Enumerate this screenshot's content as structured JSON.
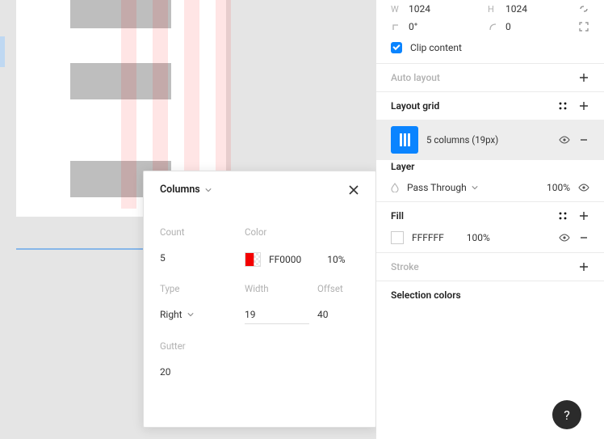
{
  "popup": {
    "title": "Columns",
    "count_label": "Count",
    "count_value": "5",
    "color_label": "Color",
    "color_hex": "FF0000",
    "color_opacity": "10%",
    "type_label": "Type",
    "type_value": "Right",
    "width_label": "Width",
    "width_value": "19",
    "offset_label": "Offset",
    "offset_value": "40",
    "gutter_label": "Gutter",
    "gutter_value": "20"
  },
  "panel": {
    "dim": {
      "w_label": "W",
      "w_value": "1024",
      "h_label": "H",
      "h_value": "1024",
      "r_label_icon": "rotation",
      "r_value": "0°",
      "c_label_icon": "corner",
      "c_value": "0"
    },
    "clip_label": "Clip content",
    "auto_layout": "Auto layout",
    "layout_grid": {
      "title": "Layout grid",
      "row_text": "5 columns (19px)"
    },
    "layer": {
      "title": "Layer",
      "blend": "Pass Through",
      "opacity": "100%"
    },
    "fill": {
      "title": "Fill",
      "hex": "FFFFFF",
      "opacity": "100%"
    },
    "stroke": {
      "title": "Stroke"
    },
    "selection_colors": "Selection colors"
  },
  "help": "?"
}
